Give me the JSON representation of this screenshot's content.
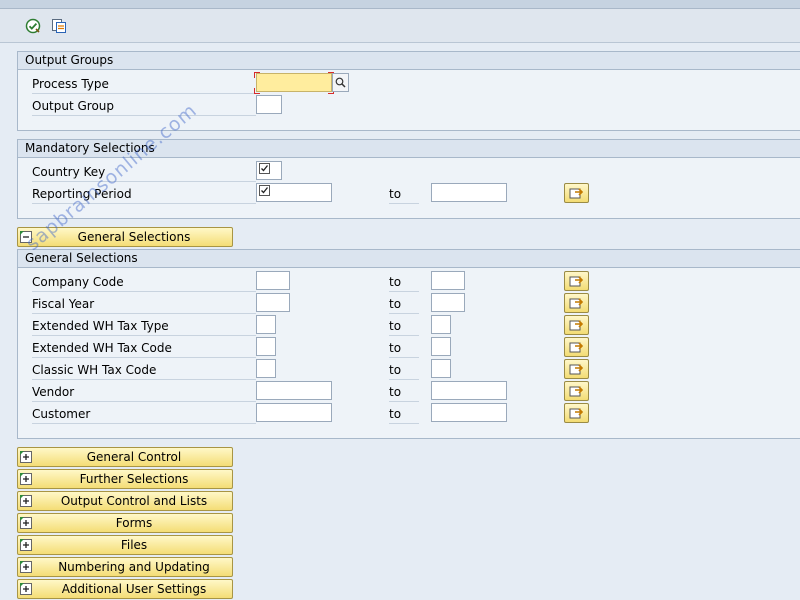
{
  "toolbar": {
    "execute_icon": "execute-icon",
    "variant_icon": "get-variant-icon"
  },
  "groups": {
    "output_groups": {
      "title": "Output Groups",
      "process_type": "Process Type",
      "output_group": "Output Group"
    },
    "mandatory": {
      "title": "Mandatory Selections",
      "country_key": "Country Key",
      "reporting_period": "Reporting Period"
    },
    "general": {
      "title": "General Selections",
      "rows": [
        {
          "label": "Company Code"
        },
        {
          "label": "Fiscal Year"
        },
        {
          "label": "Extended WH Tax Type"
        },
        {
          "label": "Extended WH Tax Code"
        },
        {
          "label": "Classic WH Tax Code"
        },
        {
          "label": "Vendor"
        },
        {
          "label": "Customer"
        }
      ]
    }
  },
  "to_label": "to",
  "expander_general": "General Selections",
  "expanders": [
    "General Control",
    "Further Selections",
    "Output Control and Lists",
    "Forms",
    "Files",
    "Numbering and Updating",
    "Additional User Settings"
  ],
  "watermark": "sapbrainsonline.com",
  "colors": {
    "required_field": "#ffed9e",
    "button_yellow": "#f4dd76",
    "group_border": "#a8b8ca"
  }
}
